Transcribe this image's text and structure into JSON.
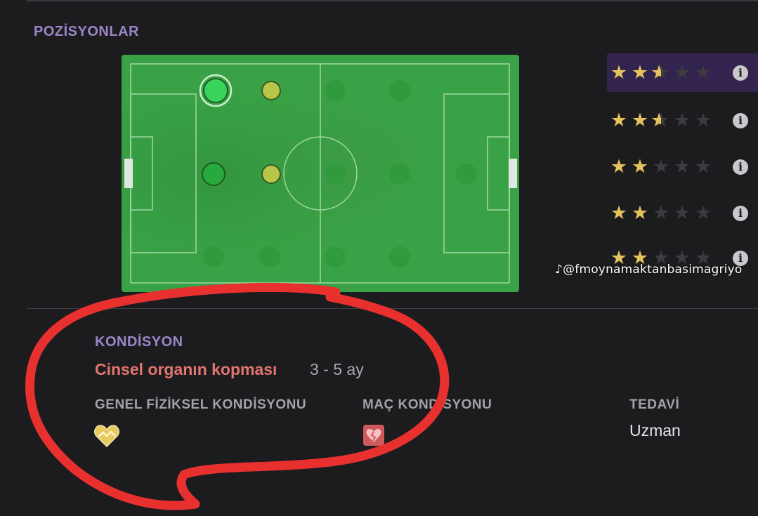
{
  "positions": {
    "title": "POZİSYONLAR",
    "pitch_color": "#3aa246",
    "ratings": [
      {
        "stars": 2.5,
        "selected": true
      },
      {
        "stars": 2.5,
        "selected": false
      },
      {
        "stars": 2,
        "selected": false
      },
      {
        "stars": 2,
        "selected": false
      },
      {
        "stars": 2,
        "selected": false
      }
    ],
    "info_icon": "info-icon",
    "star_color": "#e4c25c",
    "selected_row_color": "#33244f"
  },
  "watermark": {
    "icon": "tiktok-icon",
    "text": "@fmoynamaktanbasimagriyo"
  },
  "condition": {
    "title": "KONDİSYON",
    "injury_name": "Cinsel organın kopması",
    "injury_duration": "3 - 5 ay",
    "general_label": "GENEL FİZİKSEL KONDİSYONU",
    "general_icon": "heart-icon",
    "match_label": "MAÇ KONDİSYONU",
    "match_icon": "broken-heart-icon",
    "treatment_label": "TEDAVİ",
    "treatment_value": "Uzman",
    "injury_color": "#e1766f"
  },
  "annotation": {
    "type": "hand-drawn-red-circle",
    "color": "#e8312f"
  }
}
